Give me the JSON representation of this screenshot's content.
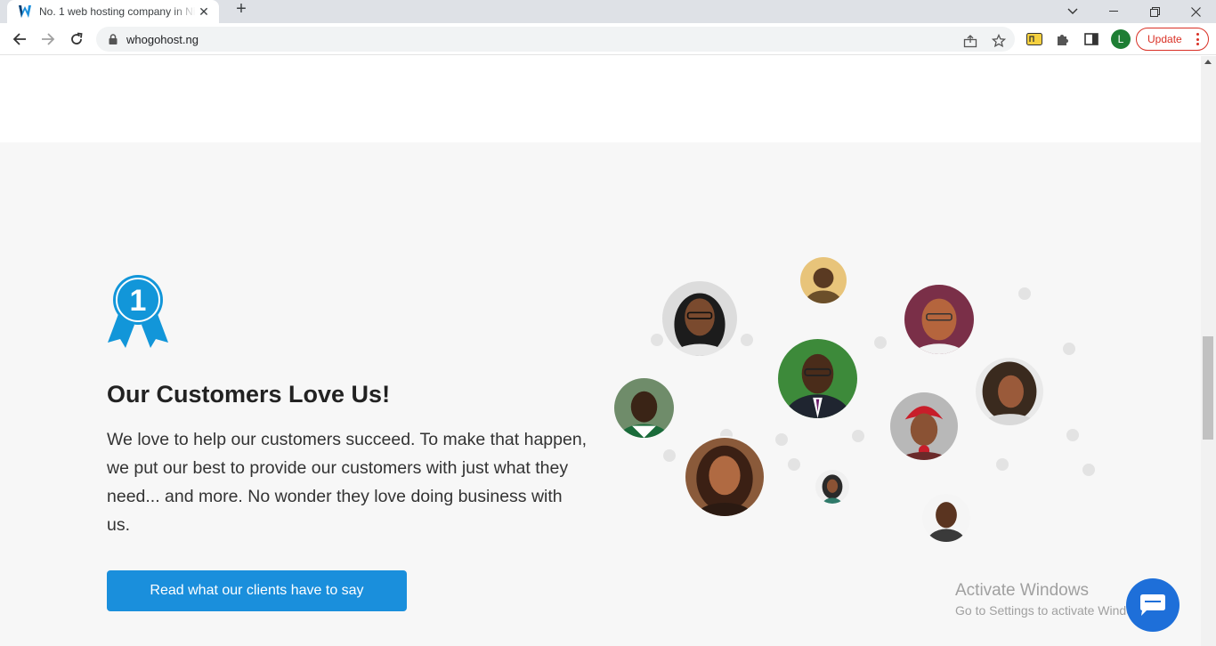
{
  "browser": {
    "tab_title": "No. 1 web hosting company in Nigeria",
    "tab_close": "✕",
    "new_tab": "+",
    "url": "whogohost.ng",
    "profile_initial": "L",
    "update_label": "Update"
  },
  "page": {
    "badge_number": "1",
    "heading": "Our Customers Love Us!",
    "body": "We love to help our customers succeed. To make that happen, we put our best to provide our customers with just what they need... and more. No wonder they love doing business with us.",
    "cta_label": "Read what our clients have to say"
  },
  "overlay": {
    "activate_title": "Activate Windows",
    "activate_sub": "Go to Settings to activate Windows."
  },
  "colors": {
    "accent": "#1a8fdc",
    "badge": "#1296d9",
    "chat": "#1e6fd9",
    "update": "#d93025"
  }
}
